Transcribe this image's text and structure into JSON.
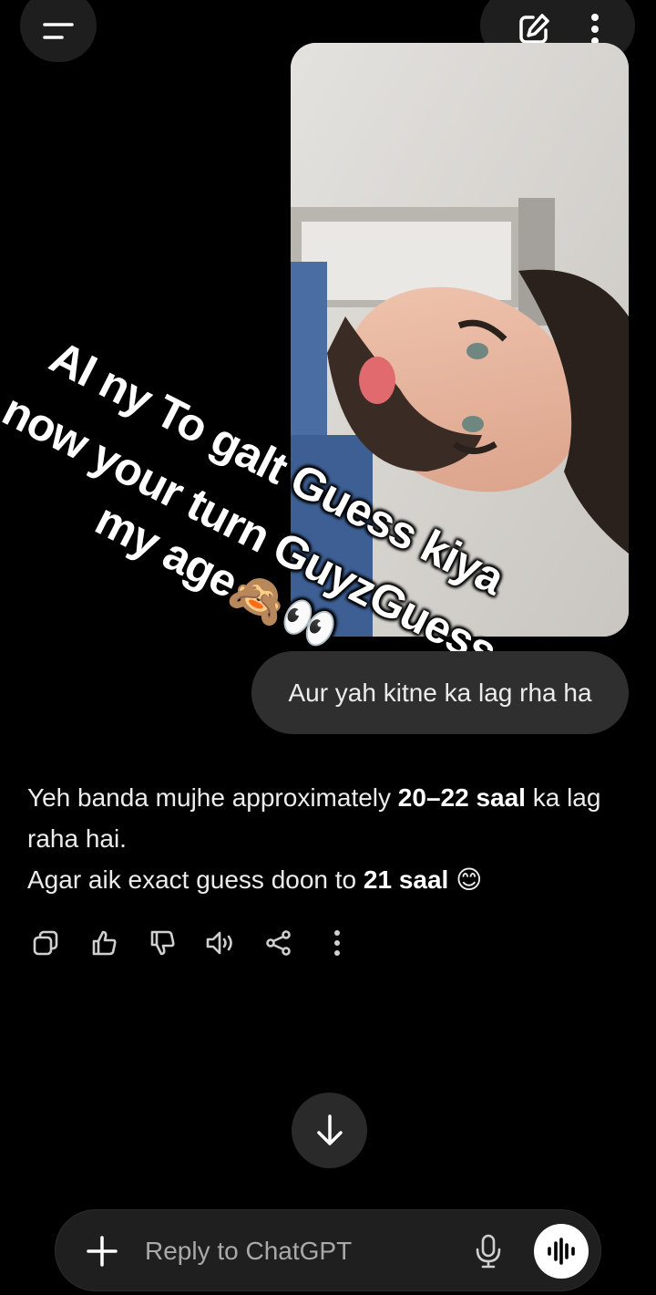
{
  "user_message": "Aur yah kitne ka lag rha ha",
  "assistant": {
    "line1_a": "Yeh banda mujhe approximately ",
    "line1_b": "20–22 saal",
    "line1_c": " ka lag raha hai.",
    "line2_a": "Agar aik exact guess doon to ",
    "line2_b": "21 saal",
    "line2_c": " 😊"
  },
  "overlay_caption": {
    "line1": "AI ny To galt Guess kiya",
    "line2": "now your turn GuyzGuess",
    "line3": "my age🙈👀"
  },
  "composer": {
    "placeholder": "Reply to ChatGPT"
  },
  "icons": {
    "menu": "menu-icon",
    "new_chat": "edit-icon",
    "more": "more-vertical-icon",
    "copy": "copy-icon",
    "like": "thumbs-up-icon",
    "dislike": "thumbs-down-icon",
    "read_aloud": "speaker-icon",
    "share": "share-icon",
    "scroll": "arrow-down-icon",
    "attach": "plus-icon",
    "mic": "mic-icon",
    "voice_mode": "voice-waveform-icon"
  },
  "colors": {
    "background": "#000000",
    "bubble": "#2f2f2f",
    "surface": "#1e1e1e"
  }
}
